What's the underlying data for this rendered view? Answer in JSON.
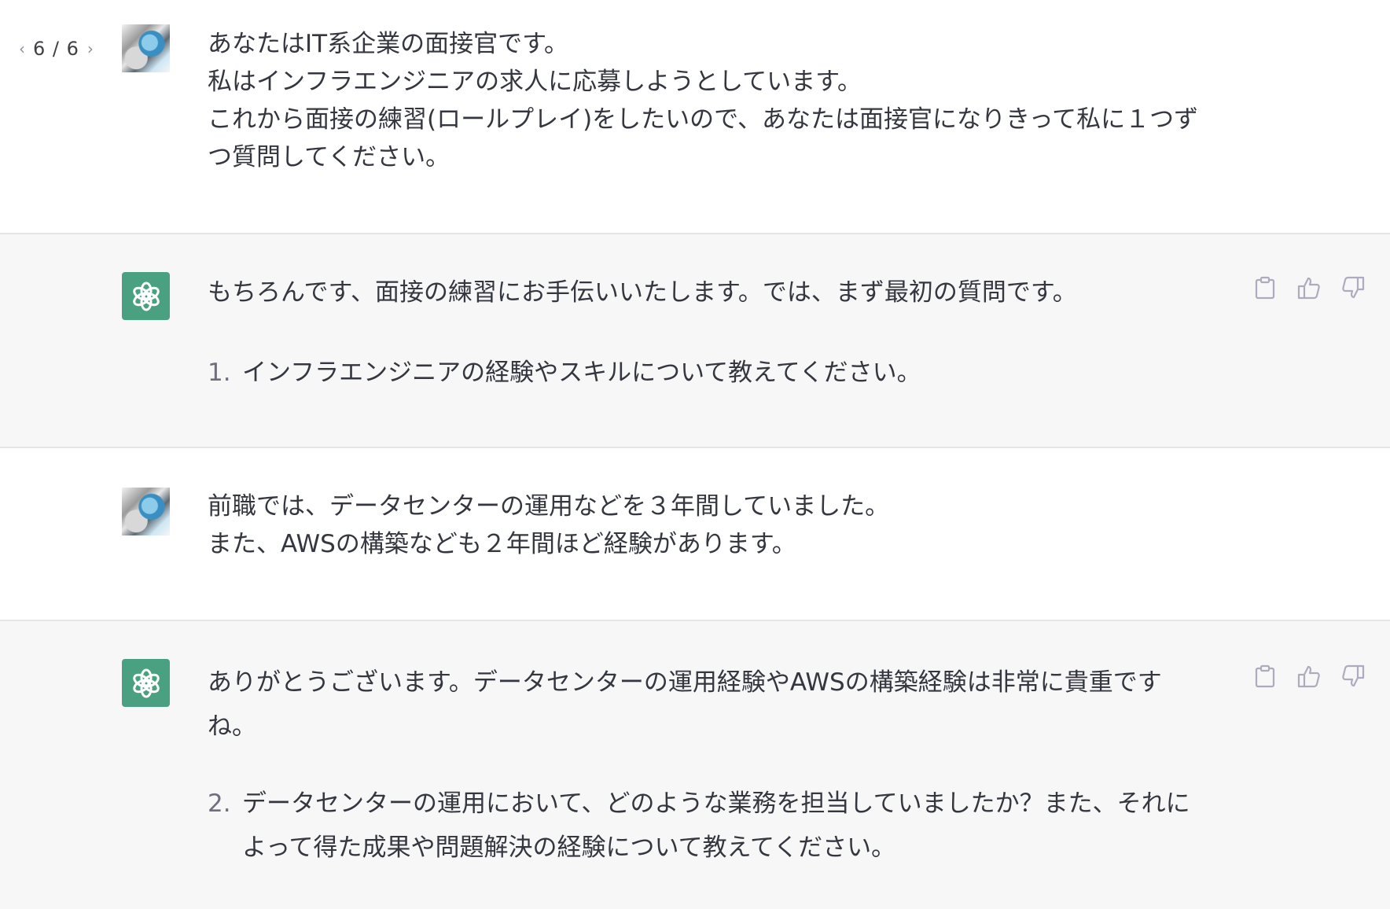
{
  "pager": {
    "prev_icon": "chevron-left-icon",
    "count": "6 / 6",
    "next_icon": "chevron-right-icon"
  },
  "messages": [
    {
      "role": "user",
      "text": "あなたはIT系企業の面接官です。\n私はインフラエンジニアの求人に応募しようとしています。\nこれから面接の練習(ロールプレイ)をしたいので、あなたは面接官になりきって私に１つず\nつ質問してください。"
    },
    {
      "role": "assistant",
      "text": "もちろんです、面接の練習にお手伝いいたします。では、まず最初の質問です。",
      "list_number": "1.",
      "list_text": "インフラエンジニアの経験やスキルについて教えてください。"
    },
    {
      "role": "user",
      "text": "前職では、データセンターの運用などを３年間していました。\nまた、AWSの構築なども２年間ほど経験があります。"
    },
    {
      "role": "assistant",
      "text": "ありがとうございます。データセンターの運用経験やAWSの構築経験は非常に貴重です\nね。",
      "list_number": "2.",
      "list_text": "データセンターの運用において、どのような業務を担当していましたか？また、それに\nよって得た成果や問題解決の経験について教えてください。"
    }
  ],
  "icons": {
    "copy": "clipboard-icon",
    "like": "thumbs-up-icon",
    "dislike": "thumbs-down-icon",
    "assistant_avatar": "chatgpt-logo-icon"
  },
  "colors": {
    "assistant_bg": "#f7f7f8",
    "gpt_green": "#4aa181",
    "text": "#353740"
  }
}
